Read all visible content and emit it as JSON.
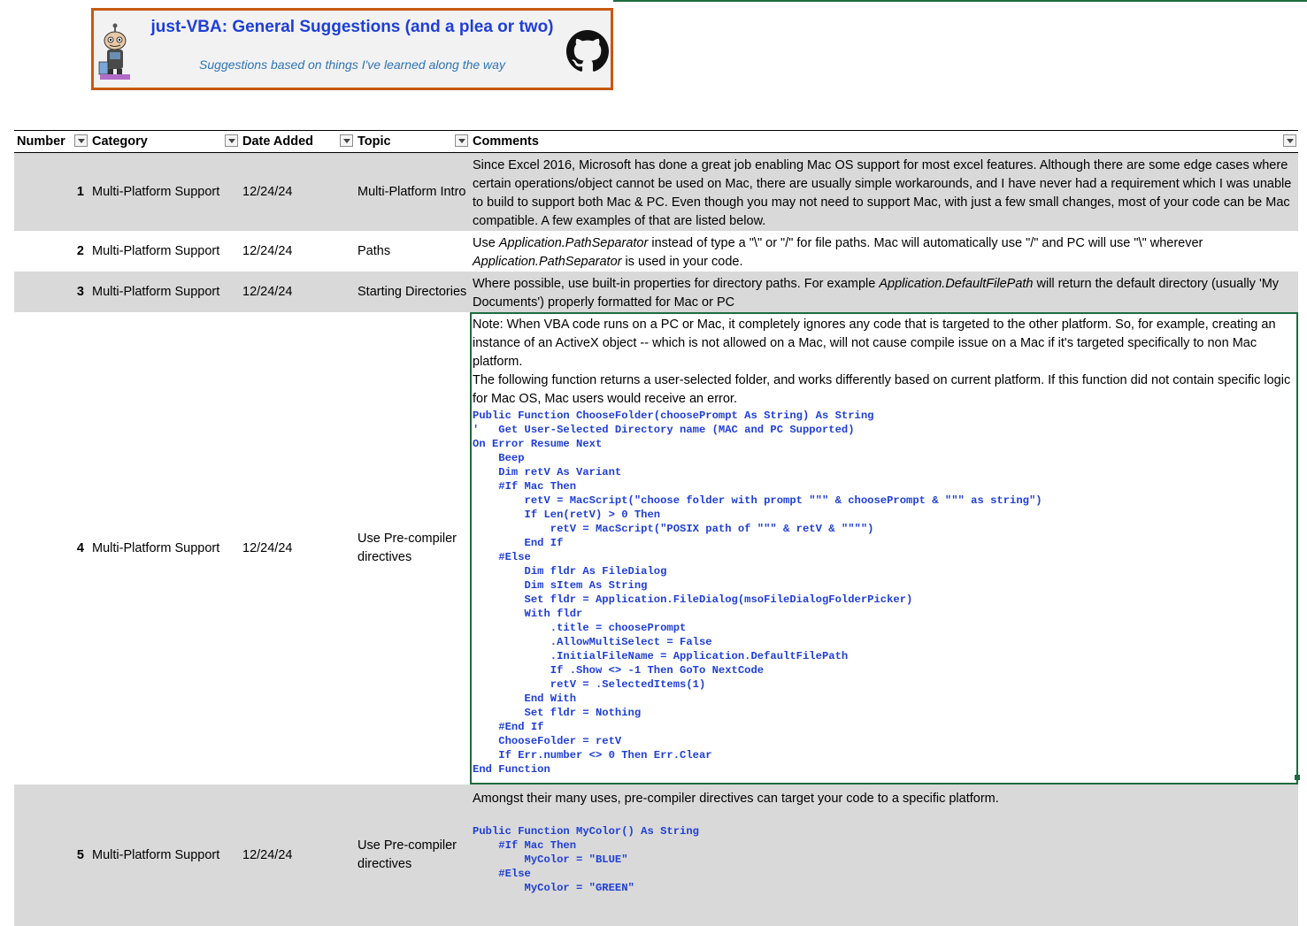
{
  "banner": {
    "title": "just-VBA: General Suggestions (and a plea or two)",
    "subtitle": "Suggestions based on things I've learned along the way",
    "avatar_icon": "cartoon-robot-avatar",
    "github_icon": "github-icon",
    "border_color": "#c55a11",
    "title_color": "#1f3fd6"
  },
  "table": {
    "headers": {
      "number": "Number",
      "category": "Category",
      "date_added": "Date Added",
      "topic": "Topic",
      "comments": "Comments"
    },
    "rows": [
      {
        "number": "1",
        "category": "Multi-Platform Support",
        "date": "12/24/24",
        "topic": "Multi-Platform Intro",
        "comment": "Since Excel 2016, Microsoft has done a great job enabling Mac OS support for most excel features.  Although there are some edge cases where certain operations/object cannot be used on Mac, there are usually simple workarounds, and I have never had a requirement which I was unable to build to support both Mac & PC. Even though you may not need to support Mac, with just a few small changes, most of your code can be Mac compatible.  A few examples of that are listed below."
      },
      {
        "number": "2",
        "category": "Multi-Platform Support",
        "date": "12/24/24",
        "topic": "Paths",
        "comment_a": "Use ",
        "comment_b": "Application.PathSeparator",
        "comment_c": "  instead of type a \"\\\" or \"/\" for file paths.   Mac will automatically use \"/\" and PC will use \"\\\" wherever ",
        "comment_d": "Application.PathSeparator",
        "comment_e": "  is used in your code."
      },
      {
        "number": "3",
        "category": "Multi-Platform Support",
        "date": "12/24/24",
        "topic": "Starting Directories",
        "comment_a": "Where possible, use built-in properties for directory paths.  For example ",
        "comment_b": "Application.DefaultFilePath",
        "comment_c": "  will return the default directory (usually 'My Documents') properly formatted for Mac or PC"
      },
      {
        "number": "4",
        "category": "Multi-Platform Support",
        "date": "12/24/24",
        "topic": "Use Pre-compiler directives",
        "comment_p1": "Note: When VBA code runs on a PC or Mac, it completely ignores any code that is targeted to the other platform.  So, for example, creating an instance of an ActiveX object -- which is not allowed on a Mac, will not cause compile issue on a Mac if it's targeted specifically to non Mac platform.",
        "comment_p2": "The following function returns a user-selected folder, and works differently based on current platform.   If this function did not contain specific logic for Mac OS, Mac users would receive an error.",
        "code": "Public Function ChooseFolder(choosePrompt As String) As String\n'   Get User-Selected Directory name (MAC and PC Supported)\nOn Error Resume Next\n    Beep\n    Dim retV As Variant\n    #If Mac Then\n        retV = MacScript(\"choose folder with prompt \"\"\" & choosePrompt & \"\"\" as string\")\n        If Len(retV) > 0 Then\n            retV = MacScript(\"POSIX path of \"\"\" & retV & \"\"\"\")\n        End If\n    #Else\n        Dim fldr As FileDialog\n        Dim sItem As String\n        Set fldr = Application.FileDialog(msoFileDialogFolderPicker)\n        With fldr\n            .title = choosePrompt\n            .AllowMultiSelect = False\n            .InitialFileName = Application.DefaultFilePath\n            If .Show <> -1 Then GoTo NextCode\n            retV = .SelectedItems(1)\n        End With\n        Set fldr = Nothing\n    #End If\n    ChooseFolder = retV\n    If Err.number <> 0 Then Err.Clear\nEnd Function"
      },
      {
        "number": "5",
        "category": "Multi-Platform Support",
        "date": "12/24/24",
        "topic": "Use Pre-compiler directives",
        "comment_p1": "Amongst their many uses, pre-compiler directives can target your code to a specific platform.",
        "code": "Public Function MyColor() As String\n    #If Mac Then\n        MyColor = \"BLUE\"\n    #Else\n        MyColor = \"GREEN\""
      }
    ]
  },
  "colors": {
    "band": "#d9d9d9",
    "selection": "#1e6b3f",
    "code": "#1f3fd6"
  }
}
